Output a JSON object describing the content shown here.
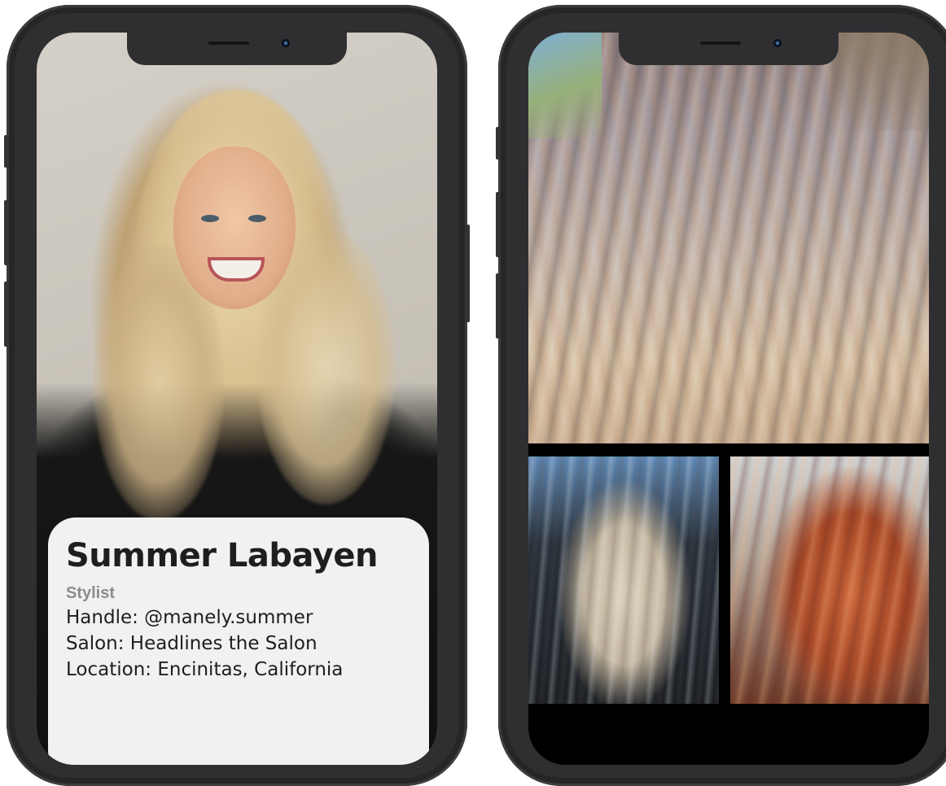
{
  "profile": {
    "name": "Summer Labayen",
    "role": "Stylist",
    "handle": "Handle: @manely.summer",
    "salon": "Salon: Headlines the Salon",
    "location": "Location: Encinitas, California"
  },
  "gallery": {
    "photo_count": 3
  },
  "colors": {
    "phone_frame": "#2f2f31",
    "card_background": "#ffffff",
    "name_text": "#1e1e1e",
    "role_text": "#8c8c8c"
  }
}
